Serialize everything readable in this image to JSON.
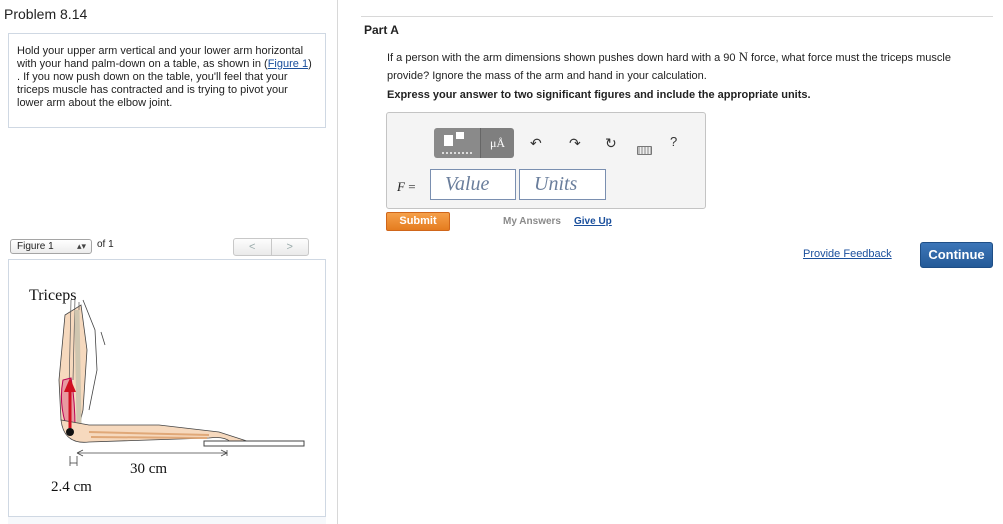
{
  "problem": {
    "title": "Problem 8.14"
  },
  "intro": {
    "text_before": "Hold your upper arm vertical and your lower arm horizontal with your hand palm-down on a table, as shown in (",
    "figure_link": "Figure 1",
    "text_after": ") . If you now push down on the table, you'll feel that your triceps muscle has contracted and is trying to pivot your lower arm about the elbow joint."
  },
  "figure_nav": {
    "selected": "Figure 1",
    "of_label": "of 1",
    "prev_label": "<",
    "next_label": ">"
  },
  "figure": {
    "muscle_label": "Triceps",
    "dim_long": "30 cm",
    "dim_short": "2.4 cm"
  },
  "part": {
    "title": "Part A",
    "question_before": "If a person with the arm dimensions shown pushes down hard with a 90 ",
    "question_unit": "N",
    "question_after": " force, what force must the triceps muscle provide? Ignore the mass of the arm and hand in your calculation.",
    "instruction": "Express your answer to two significant figures and include the appropriate units."
  },
  "answer": {
    "variable": "F",
    "equals": " =",
    "value_placeholder": "Value",
    "units_placeholder": "Units",
    "toolbar": {
      "mu_label": "μÅ",
      "help_label": "?",
      "undo_icon": "↶",
      "redo_icon": "↷",
      "reset_icon": "↻"
    }
  },
  "actions": {
    "submit": "Submit",
    "my_answers": "My Answers",
    "give_up": "Give Up",
    "feedback": "Provide Feedback",
    "continue": "Continue"
  },
  "colors": {
    "link": "#1a4f9c",
    "submit_orange": "#e57c1f",
    "continue_blue": "#245a98",
    "input_border": "#7a8fb0"
  }
}
